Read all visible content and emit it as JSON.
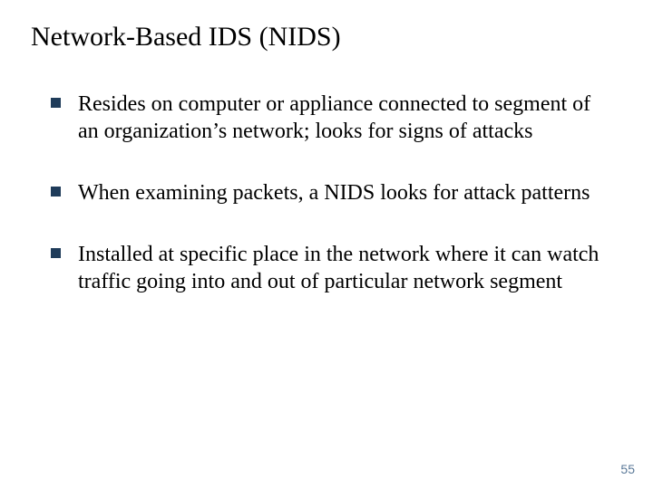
{
  "title": "Network-Based IDS (NIDS)",
  "bullets": [
    "Resides on computer or appliance connected to segment of an organization’s network; looks for signs of attacks",
    "When examining packets, a NIDS looks for attack patterns",
    "Installed at specific place in the network where it can watch traffic going into and out of particular network segment"
  ],
  "page_number": "55"
}
